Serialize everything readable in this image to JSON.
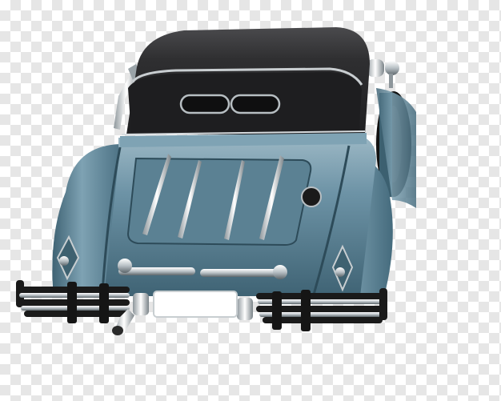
{
  "image": {
    "subject": "vintage-car-rear-view",
    "background": "transparency-checkerboard"
  },
  "colors": {
    "body_paint": "#5f8598",
    "body_paint_dark": "#2e4b5a",
    "body_paint_light": "#a8c3cf",
    "roof": "#2e2e30",
    "roof_highlight": "#555558",
    "chrome": "#d8dde0",
    "chrome_dark": "#6b7277",
    "tire": "#111111",
    "plate": "#ffffff",
    "checker_light": "#ffffff",
    "checker_dark": "#e6e6e6"
  }
}
